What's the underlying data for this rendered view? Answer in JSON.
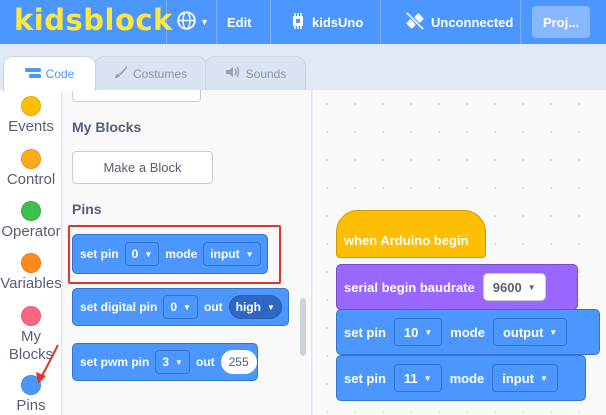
{
  "menubar": {
    "logo": "kidsblock",
    "edit": "Edit",
    "board": "kidsUno",
    "connection": "Unconnected",
    "project": "Proj..."
  },
  "tabs": [
    {
      "label": "Code",
      "active": true
    },
    {
      "label": "Costumes",
      "active": false
    },
    {
      "label": "Sounds",
      "active": false
    }
  ],
  "categories": [
    {
      "label": "Events",
      "color": "#ffbf00"
    },
    {
      "label": "Control",
      "color": "#ffab19"
    },
    {
      "label": "Operators",
      "label_visible": "Operator",
      "color": "#40bf4a"
    },
    {
      "label": "Variables",
      "color": "#ff8c1a"
    },
    {
      "label": "My Blocks",
      "color": "#ff6680"
    },
    {
      "label": "Pins",
      "color": "#4c97ff"
    }
  ],
  "palette": {
    "my_blocks_title": "My Blocks",
    "make_block": "Make a Block",
    "pins_title": "Pins",
    "set_pin": {
      "label1": "set pin",
      "pin": "0",
      "label2": "mode",
      "mode": "input"
    },
    "set_digital": {
      "label1": "set digital pin",
      "pin": "0",
      "label2": "out",
      "value": "high"
    },
    "set_pwm": {
      "label1": "set pwm pin",
      "pin": "3",
      "label2": "out",
      "value": "255"
    }
  },
  "script": {
    "hat": "when Arduino begin",
    "serial": {
      "label": "serial begin baudrate",
      "value": "9600"
    },
    "pin1": {
      "label1": "set pin",
      "pin": "10",
      "label2": "mode",
      "mode": "output"
    },
    "pin2": {
      "label1": "set pin",
      "pin": "11",
      "label2": "mode",
      "mode": "input"
    }
  },
  "colors": {
    "brand": "#4c97ff",
    "logo": "#fde63f",
    "events": "#ffbf00",
    "serial": "#9966ff",
    "highlight": "#e2342f"
  }
}
